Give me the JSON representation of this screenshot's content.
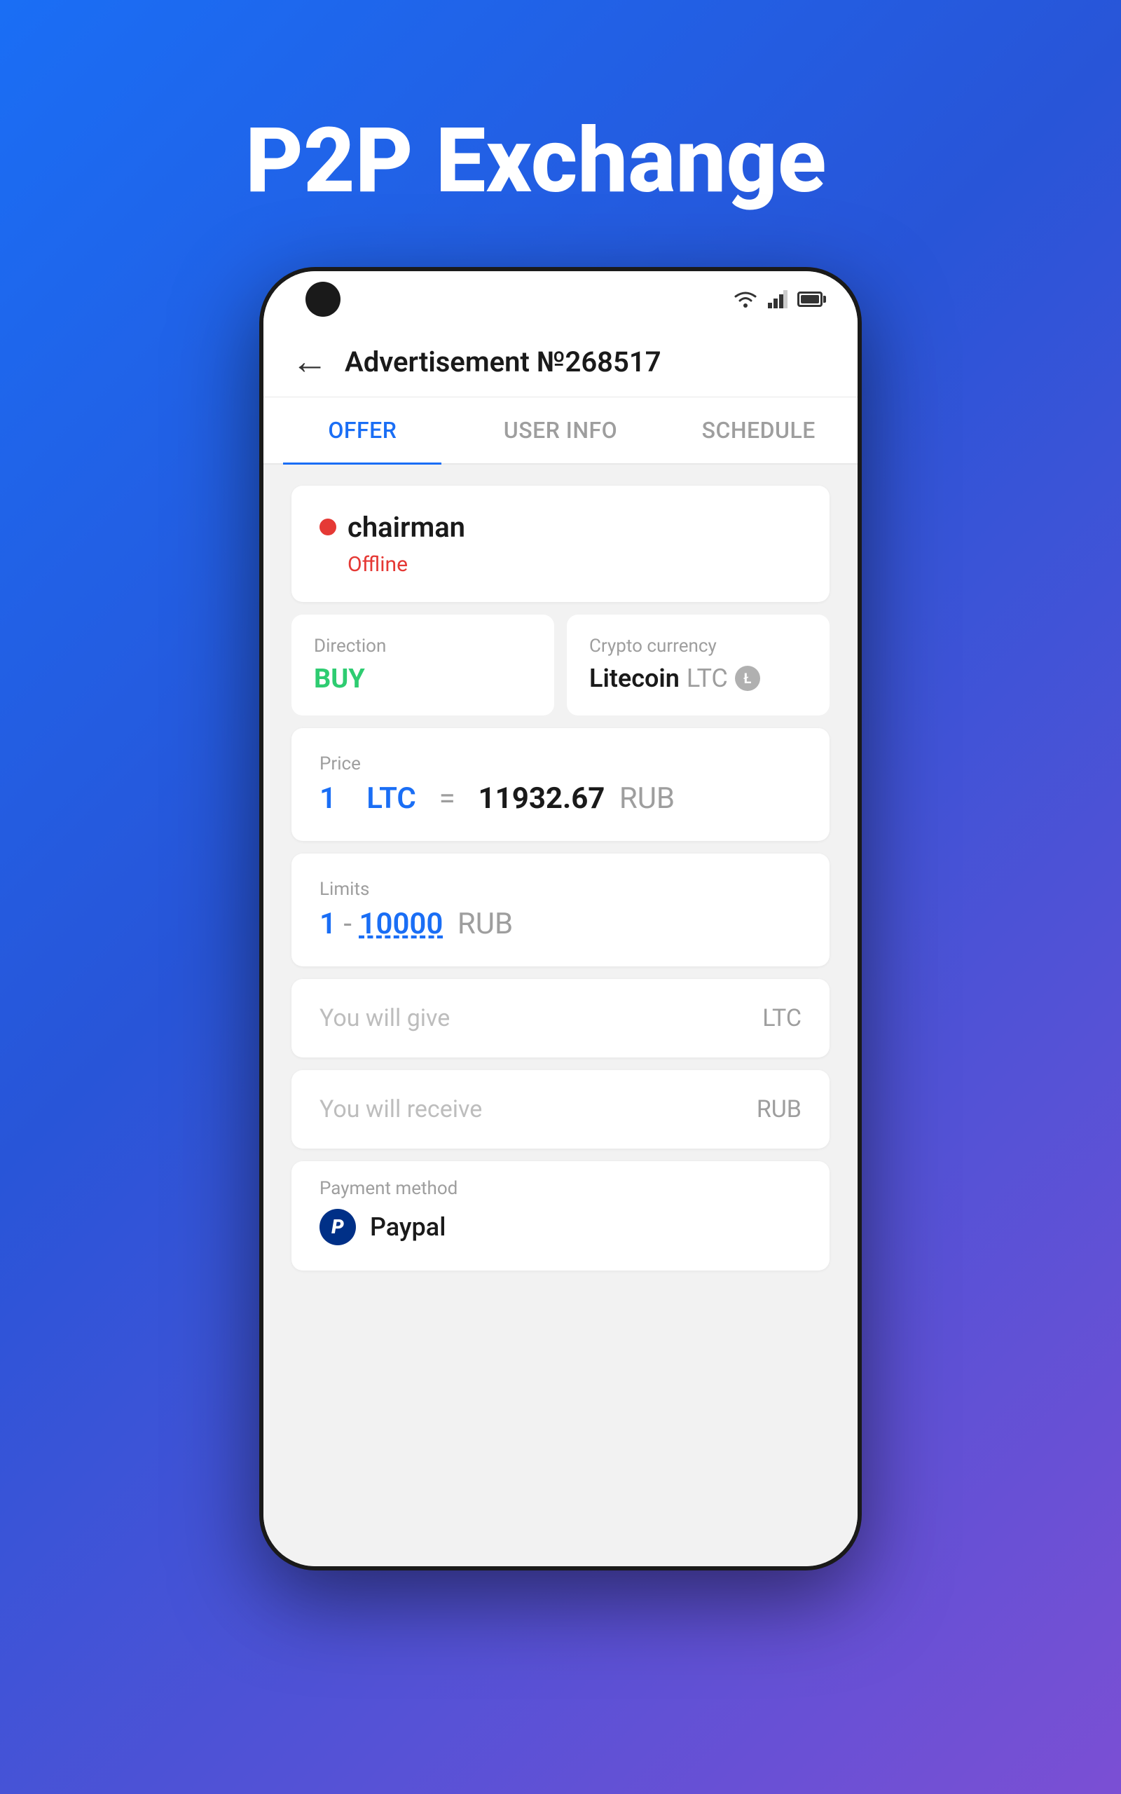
{
  "background": {
    "gradient_start": "#1a6ef5",
    "gradient_end": "#7b4fd4"
  },
  "hero": {
    "title": "P2P Exchange"
  },
  "phone": {
    "status_bar": {
      "wifi": "wifi-icon",
      "signal": "signal-icon",
      "battery": "battery-icon"
    },
    "header": {
      "back_label": "←",
      "title": "Advertisement №268517"
    },
    "tabs": [
      {
        "id": "offer",
        "label": "OFFER",
        "active": true
      },
      {
        "id": "user_info",
        "label": "USER INFO",
        "active": false
      },
      {
        "id": "schedule",
        "label": "SCHEDULE",
        "active": false
      }
    ],
    "offer": {
      "user": {
        "name": "chairman",
        "status_dot_color": "#e53935",
        "status": "Offline"
      },
      "direction": {
        "label": "Direction",
        "value": "BUY"
      },
      "crypto_currency": {
        "label": "Crypto currency",
        "name": "Litecoin",
        "symbol": "LTC"
      },
      "price": {
        "label": "Price",
        "amount": "1",
        "crypto": "LTC",
        "equals": "=",
        "value": "11932.67",
        "fiat": "RUB"
      },
      "limits": {
        "label": "Limits",
        "min": "1",
        "max": "10000",
        "currency": "RUB"
      },
      "give_input": {
        "placeholder": "You will give",
        "currency": "LTC"
      },
      "receive_input": {
        "placeholder": "You will receive",
        "currency": "RUB"
      },
      "payment_method": {
        "label": "Payment method",
        "name": "Paypal"
      }
    }
  }
}
